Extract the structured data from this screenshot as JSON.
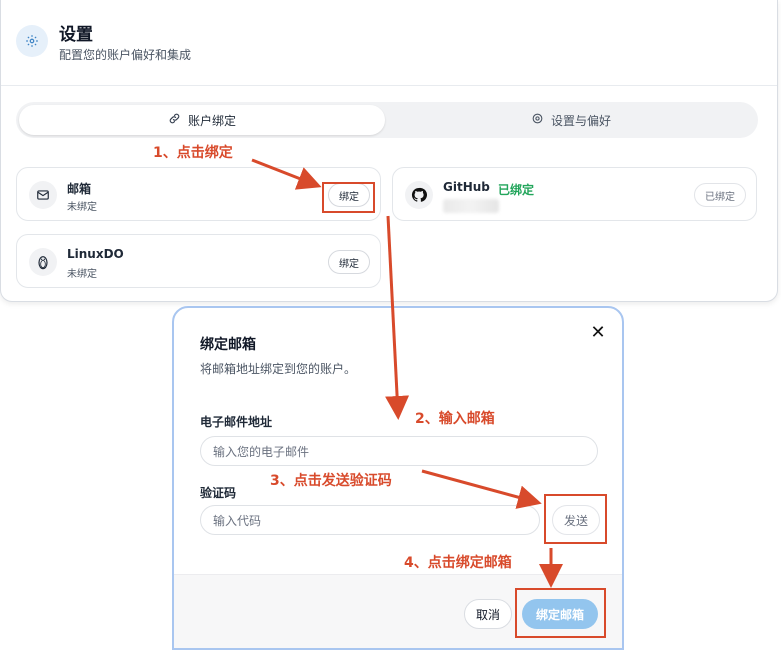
{
  "settings": {
    "title": "设置",
    "subtitle": "配置您的账户偏好和集成",
    "header_icon": "gear-icon"
  },
  "tabs": [
    {
      "label": "账户绑定",
      "icon": "link-icon",
      "active": true
    },
    {
      "label": "设置与偏好",
      "icon": "gear-icon",
      "active": false
    }
  ],
  "accounts": {
    "email": {
      "name": "邮箱",
      "status": "未绑定",
      "button": "绑定",
      "icon": "mail-icon"
    },
    "linuxdo": {
      "name": "LinuxDO",
      "status": "未绑定",
      "button": "绑定",
      "icon": "penguin-icon"
    },
    "github": {
      "name": "GitHub",
      "tag": "已绑定",
      "button": "已绑定",
      "icon": "github-icon"
    }
  },
  "dialog": {
    "title": "绑定邮箱",
    "description": "将邮箱地址绑定到您的账户。",
    "email_label": "电子邮件地址",
    "email_placeholder": "输入您的电子邮件",
    "code_label": "验证码",
    "code_placeholder": "输入代码",
    "send_button": "发送",
    "cancel_button": "取消",
    "confirm_button": "绑定邮箱"
  },
  "annotations": {
    "step1": "1、点击绑定",
    "step2": "2、输入邮箱",
    "step3": "3、点击发送验证码",
    "step4": "4、点击绑定邮箱",
    "color": "#d84a2b"
  },
  "colors": {
    "accent": "#93c5ee",
    "bound_green": "#22a55b",
    "dialog_border": "#a9c6f0"
  }
}
